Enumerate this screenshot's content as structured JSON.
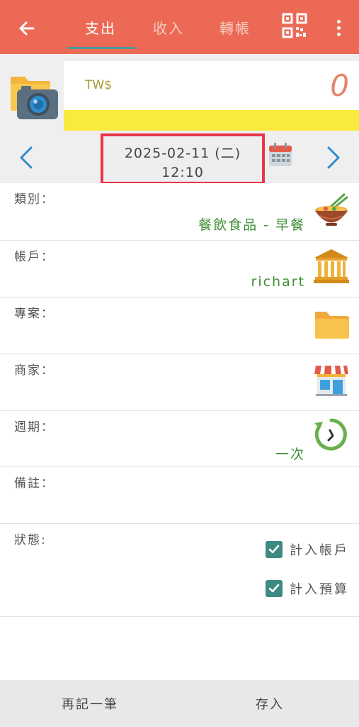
{
  "header": {
    "tabs": [
      {
        "label": "支出",
        "active": true
      },
      {
        "label": "收入",
        "active": false
      },
      {
        "label": "轉帳",
        "active": false
      }
    ],
    "accent_color": "#ec6a55",
    "icons": {
      "back": "arrow-left-icon",
      "qr": "qr-code-icon",
      "more": "more-vertical-icon"
    }
  },
  "amount": {
    "currency": "TW$",
    "value": "0",
    "icon": "camera-folder-icon"
  },
  "date": {
    "date": "2025-02-11 (二)",
    "time": "12:10",
    "icons": {
      "prev": "chevron-left-icon",
      "next": "chevron-right-icon",
      "calendar": "calendar-icon"
    }
  },
  "fields": [
    {
      "label": "類別：",
      "value": "餐飲食品 - 早餐",
      "icon": "noodle-bowl-icon"
    },
    {
      "label": "帳戶：",
      "value": "richart",
      "icon": "bank-icon"
    },
    {
      "label": "專案：",
      "value": "",
      "icon": "folder-icon"
    },
    {
      "label": "商家：",
      "value": "",
      "icon": "store-icon"
    },
    {
      "label": "週期：",
      "value": "一次",
      "icon": "repeat-clock-icon"
    },
    {
      "label": "備註：",
      "value": ""
    }
  ],
  "status": {
    "label": "狀態:",
    "options": [
      {
        "label": "計入帳戶",
        "checked": true
      },
      {
        "label": "計入預算",
        "checked": true
      }
    ]
  },
  "bottom": {
    "record_another": "再記一筆",
    "save": "存入"
  }
}
